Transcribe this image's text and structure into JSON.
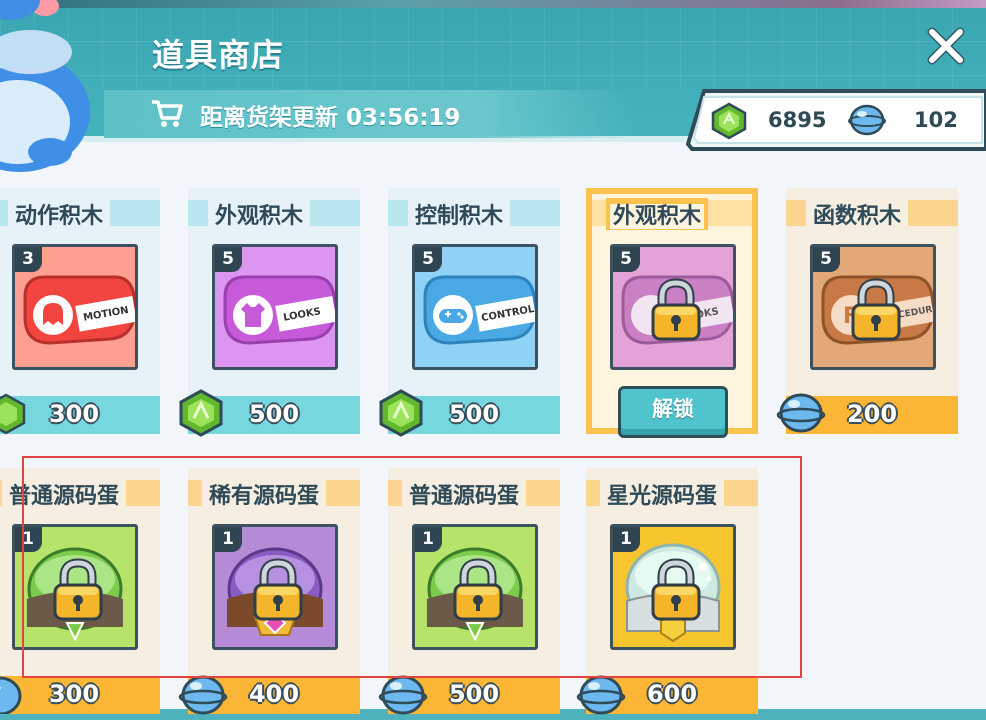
{
  "header": {
    "title": "道具商店",
    "refresh_label": "距离货架更新 03:56:19"
  },
  "currency": {
    "gem_count": "6895",
    "bubble_count": "102"
  },
  "row1": [
    {
      "title": "动作积木",
      "level": "3",
      "price": "300",
      "currency": "gem",
      "label_text": "MOTION",
      "locked": false
    },
    {
      "title": "外观积木",
      "level": "5",
      "price": "500",
      "currency": "gem",
      "label_text": "LOOKS",
      "locked": false
    },
    {
      "title": "控制积木",
      "level": "5",
      "price": "500",
      "currency": "gem",
      "label_text": "CONTROL",
      "locked": false
    },
    {
      "title": "外观积木",
      "level": "5",
      "price": "",
      "currency": "",
      "label_text": "LOOKS",
      "locked": true,
      "unlock_label": "解锁"
    },
    {
      "title": "函数积木",
      "level": "5",
      "price": "200",
      "currency": "bubble",
      "label_text": "PROCEDURE",
      "locked": true
    }
  ],
  "row2": [
    {
      "title": "普通源码蛋",
      "level": "1",
      "price": "300",
      "currency": "bubble",
      "locked": true
    },
    {
      "title": "稀有源码蛋",
      "level": "1",
      "price": "400",
      "currency": "bubble",
      "locked": true
    },
    {
      "title": "普通源码蛋",
      "level": "1",
      "price": "500",
      "currency": "bubble",
      "locked": true
    },
    {
      "title": "星光源码蛋",
      "level": "1",
      "price": "600",
      "currency": "bubble",
      "locked": true
    }
  ],
  "colors": {
    "header": "#3aa6b2",
    "gem": "#7ccf3c",
    "bubble": "#58aee8",
    "selected": "#fbc24d",
    "highlight_frame": "#e24343"
  }
}
